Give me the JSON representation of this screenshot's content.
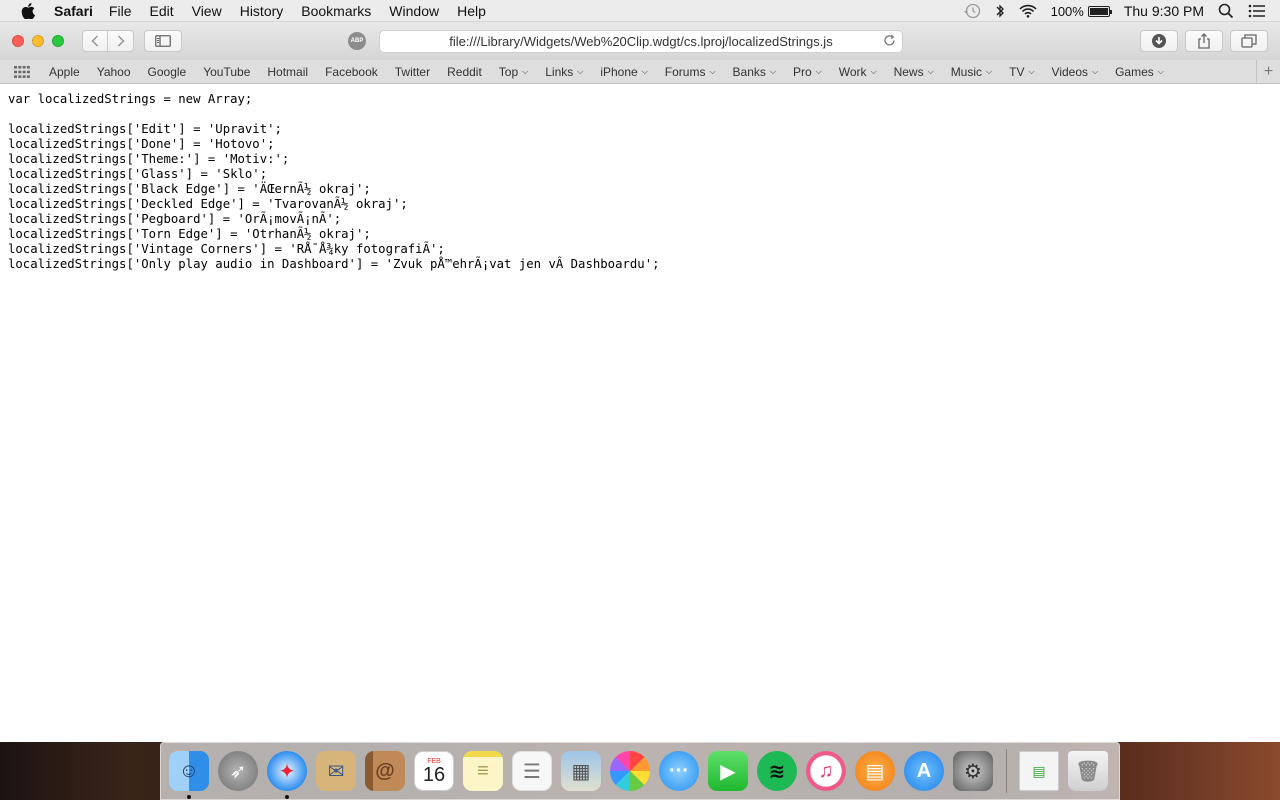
{
  "menubar": {
    "app_name": "Safari",
    "items": [
      "File",
      "Edit",
      "View",
      "History",
      "Bookmarks",
      "Window",
      "Help"
    ],
    "battery_pct": "100%",
    "clock": "Thu 9:30 PM",
    "icons": [
      "time-machine-icon",
      "bluetooth-icon",
      "wifi-icon",
      "battery-icon",
      "spotlight-icon",
      "notification-center-icon"
    ]
  },
  "window": {
    "url": "file:///Library/Widgets/Web%20Clip.wdgt/cs.lproj/localizedStrings.js",
    "abp_label": "ABP"
  },
  "bookmarks": [
    {
      "label": "Apple",
      "menu": false
    },
    {
      "label": "Yahoo",
      "menu": false
    },
    {
      "label": "Google",
      "menu": false
    },
    {
      "label": "YouTube",
      "menu": false
    },
    {
      "label": "Hotmail",
      "menu": false
    },
    {
      "label": "Facebook",
      "menu": false
    },
    {
      "label": "Twitter",
      "menu": false
    },
    {
      "label": "Reddit",
      "menu": false
    },
    {
      "label": "Top",
      "menu": true
    },
    {
      "label": "Links",
      "menu": true
    },
    {
      "label": "iPhone",
      "menu": true
    },
    {
      "label": "Forums",
      "menu": true
    },
    {
      "label": "Banks",
      "menu": true
    },
    {
      "label": "Pro",
      "menu": true
    },
    {
      "label": "Work",
      "menu": true
    },
    {
      "label": "News",
      "menu": true
    },
    {
      "label": "Music",
      "menu": true
    },
    {
      "label": "TV",
      "menu": true
    },
    {
      "label": "Videos",
      "menu": true
    },
    {
      "label": "Games",
      "menu": true
    }
  ],
  "code_lines": [
    "var localizedStrings = new Array;",
    "",
    "localizedStrings['Edit'] = 'Upravit';",
    "localizedStrings['Done'] = 'Hotovo';",
    "localizedStrings['Theme:'] = 'Motiv:';",
    "localizedStrings['Glass'] = 'Sklo';",
    "localizedStrings['Black Edge'] = 'ÄŒernÃ½ okraj';",
    "localizedStrings['Deckled Edge'] = 'TvarovanÃ½ okraj';",
    "localizedStrings['Pegboard'] = 'OrÃ¡movÃ¡nÃ­';",
    "localizedStrings['Torn Edge'] = 'OtrhanÃ½ okraj';",
    "localizedStrings['Vintage Corners'] = 'RÅ¯Å¾ky fotografiÃ­';",
    "localizedStrings['Only play audio in Dashboard'] = 'Zvuk pÅ™ehrÃ¡vat jen vÂ Dashboardu';"
  ],
  "dock": {
    "calendar_month": "FEB",
    "calendar_day": "16",
    "apps": [
      {
        "name": "finder",
        "color": "#3aa0f0",
        "glyph": "☺",
        "running": true
      },
      {
        "name": "launchpad",
        "color": "#8a8a8a",
        "glyph": "🚀",
        "running": false
      },
      {
        "name": "safari",
        "color": "#2d8ef0",
        "glyph": "✦",
        "running": true
      },
      {
        "name": "mail-stamp",
        "color": "#c9a86a",
        "glyph": "✉",
        "running": false
      },
      {
        "name": "contacts",
        "color": "#b07a48",
        "glyph": "@",
        "running": false
      },
      {
        "name": "calendar",
        "color": "#ffffff",
        "glyph": "",
        "running": false
      },
      {
        "name": "notes",
        "color": "#f7e27a",
        "glyph": "≡",
        "running": false
      },
      {
        "name": "reminders",
        "color": "#f5f5f5",
        "glyph": "☰",
        "running": false
      },
      {
        "name": "preview",
        "color": "#d8d8c8",
        "glyph": "▦",
        "running": false
      },
      {
        "name": "photos",
        "color": "#f5a623",
        "glyph": "✿",
        "running": false
      },
      {
        "name": "messages",
        "color": "#34a3f8",
        "glyph": "💬",
        "running": false
      },
      {
        "name": "facetime",
        "color": "#2ecc40",
        "glyph": "▶",
        "running": false
      },
      {
        "name": "spotify",
        "color": "#1db954",
        "glyph": "≋",
        "running": false
      },
      {
        "name": "itunes",
        "color": "#f05a8a",
        "glyph": "♫",
        "running": false
      },
      {
        "name": "ibooks",
        "color": "#f28a1e",
        "glyph": "📖",
        "running": false
      },
      {
        "name": "app-store",
        "color": "#1e8ef0",
        "glyph": "A",
        "running": false
      },
      {
        "name": "system-preferences",
        "color": "#7a7a7a",
        "glyph": "⚙",
        "running": false
      }
    ],
    "docs": [
      {
        "name": "document-stack",
        "color": "#f0f0f0",
        "glyph": "▤"
      },
      {
        "name": "trash",
        "color": "#e8e8e8",
        "glyph": "🗑"
      }
    ]
  }
}
